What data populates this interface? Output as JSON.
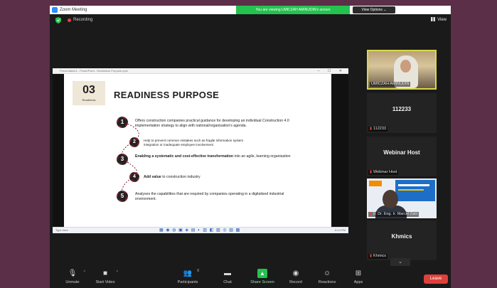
{
  "app": {
    "title": "Zoom Meeting",
    "share_banner": "You are viewing UMICZAH AMINUDIN's screen",
    "view_options": "View Options ⌄"
  },
  "status": {
    "recording_label": "Recording",
    "view_label": "View"
  },
  "shared_window": {
    "title": "Presentation1 - PowerPoint - Readiness Purpose.pptx",
    "controls": "– ☐ ✕",
    "taskbar_left": "Type here",
    "taskbar_icons": "▦ ◉ ◍ ▣ ◈ ▤ ◐ ▥ ◧ ▧ ◎ ▨ ▩",
    "taskbar_right": "8:14 PM"
  },
  "slide": {
    "number": "03",
    "number_sub": "Readiness",
    "title": "READINESS PURPOSE",
    "items": [
      {
        "n": "1",
        "bold": "",
        "text": "Offers construction companies practical guidance for developing an individual Construction 4.0 implementation strategy to align with national/organisation's agenda."
      },
      {
        "n": "2",
        "bold": "",
        "text": "Help to prevent common mistakes such as fragile information system integration or inadequate employee involvement."
      },
      {
        "n": "3",
        "bold": "Enabling a systematic and cost-effective transformation",
        "text": " into an agile, learning organisation"
      },
      {
        "n": "4",
        "bold": "Add value",
        "text": " to construction industry"
      },
      {
        "n": "5",
        "bold": "",
        "text": "Analyses the capabilities that are required by companies operating in a digitalised industrial environment."
      }
    ]
  },
  "participants": {
    "tile1_label": "UMICZAH AMINUDIN",
    "tile2_center": "112233",
    "tile2_label": "112233",
    "tile3_center": "Webinar Host",
    "tile3_label": "Webinar Host",
    "tile4_label": "Ir. Dr. Eng. Ir. Marcel Zain",
    "tile5_center": "Khmics",
    "tile5_label": "Khmics",
    "scroll": "⌄"
  },
  "toolbar": {
    "unmute": "Unmute",
    "start_video": "Start Video",
    "participants": "Participants",
    "participants_count": "8",
    "chat": "Chat",
    "share_screen": "Share Screen",
    "record": "Record",
    "reactions": "Reactions",
    "apps": "Apps",
    "leave": "Leave"
  },
  "colors": {
    "share_green": "#24c24f",
    "leave_red": "#e0403b",
    "active_speaker": "#d8d84a",
    "gear_red": "#7a2130"
  }
}
